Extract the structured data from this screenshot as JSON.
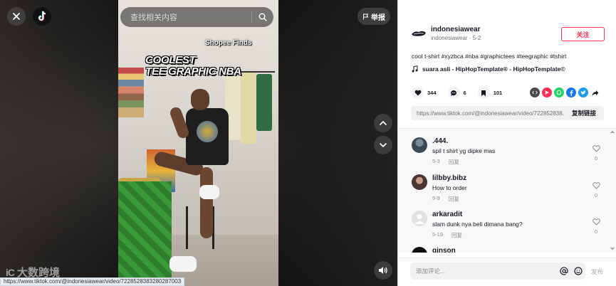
{
  "topbar": {
    "search_placeholder": "查找相关内容",
    "report_label": "举报"
  },
  "video": {
    "shopee_tag": "Shopee Finds",
    "title_line1": "COOLEST",
    "title_line2": "TEE GRAPHIC NBA"
  },
  "status_url": "https://www.tiktok.com/@indonesiawear/video/7228528383280287003",
  "watermark": {
    "logo": "iC",
    "text": "大数跨境"
  },
  "author": {
    "name": "indonesiawear",
    "subline": "indonesiawear · 5-2",
    "follow_label": "关注"
  },
  "post": {
    "caption": "cool t-shirt #xyzbca #nba #graphictees #teegraphic #tshirt",
    "music": "suara asli - HipHopTemplate® - HipHopTemplate©"
  },
  "stats": {
    "likes": "344",
    "comments": "6",
    "saves": "101"
  },
  "share_colors": {
    "embed": "#4a4a4a",
    "friends": "#fe2c55",
    "whatsapp": "#25d366",
    "facebook": "#1877f2",
    "twitter": "#1d9bf0",
    "more": "#161823"
  },
  "link": {
    "url": "https://www.tiktok.com/@indonesiawear/video/722852838...",
    "copy_label": "复制链接"
  },
  "comments": [
    {
      "name": ".444.",
      "text": "spil t shirt yg dipke mas",
      "date": "5-3",
      "reply": "回复",
      "likes": "0"
    },
    {
      "name": "lilbby.bibz",
      "text": "How to order",
      "date": "5-9",
      "reply": "回复",
      "likes": "0"
    },
    {
      "name": "arkaradit",
      "text": "slam dunk nya beli dimana bang?",
      "date": "5-19",
      "reply": "回复",
      "likes": "0"
    },
    {
      "name": "ginson"
    }
  ],
  "input": {
    "placeholder": "添加评论...",
    "post_label": "发布"
  },
  "colors": {
    "accent": "#fe2c55",
    "text": "#161823",
    "muted": "#8a8b91"
  }
}
